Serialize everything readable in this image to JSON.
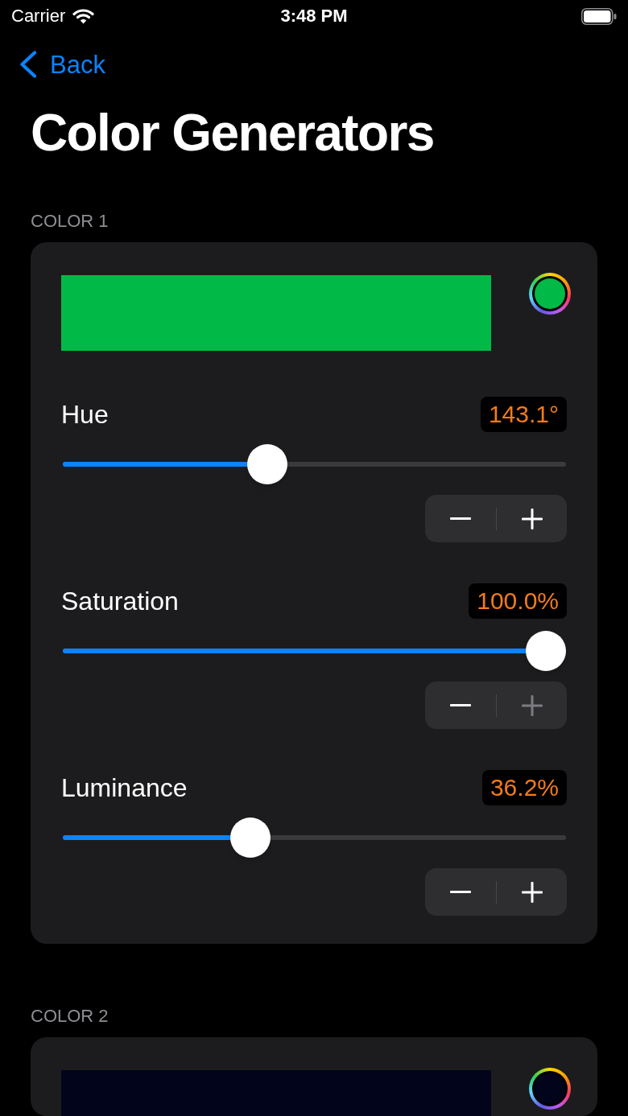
{
  "status_bar": {
    "carrier": "Carrier",
    "time": "3:48 PM"
  },
  "nav_bar": {
    "back": "Back"
  },
  "title": "Color Generators",
  "sections": [
    {
      "header": "COLOR 1",
      "color": "#00b947",
      "sliders": [
        {
          "label": "Hue",
          "reading": "143.1°",
          "level": 0.3975,
          "minus_disabled": false,
          "plus_disabled": false
        },
        {
          "label": "Saturation",
          "reading": "100.0%",
          "level": 1,
          "minus_disabled": false,
          "plus_disabled": true
        },
        {
          "label": "Luminance",
          "reading": "36.2%",
          "level": 0.362,
          "minus_disabled": false,
          "plus_disabled": false
        }
      ]
    },
    {
      "header": "COLOR 2",
      "color": "#02041c"
    }
  ]
}
